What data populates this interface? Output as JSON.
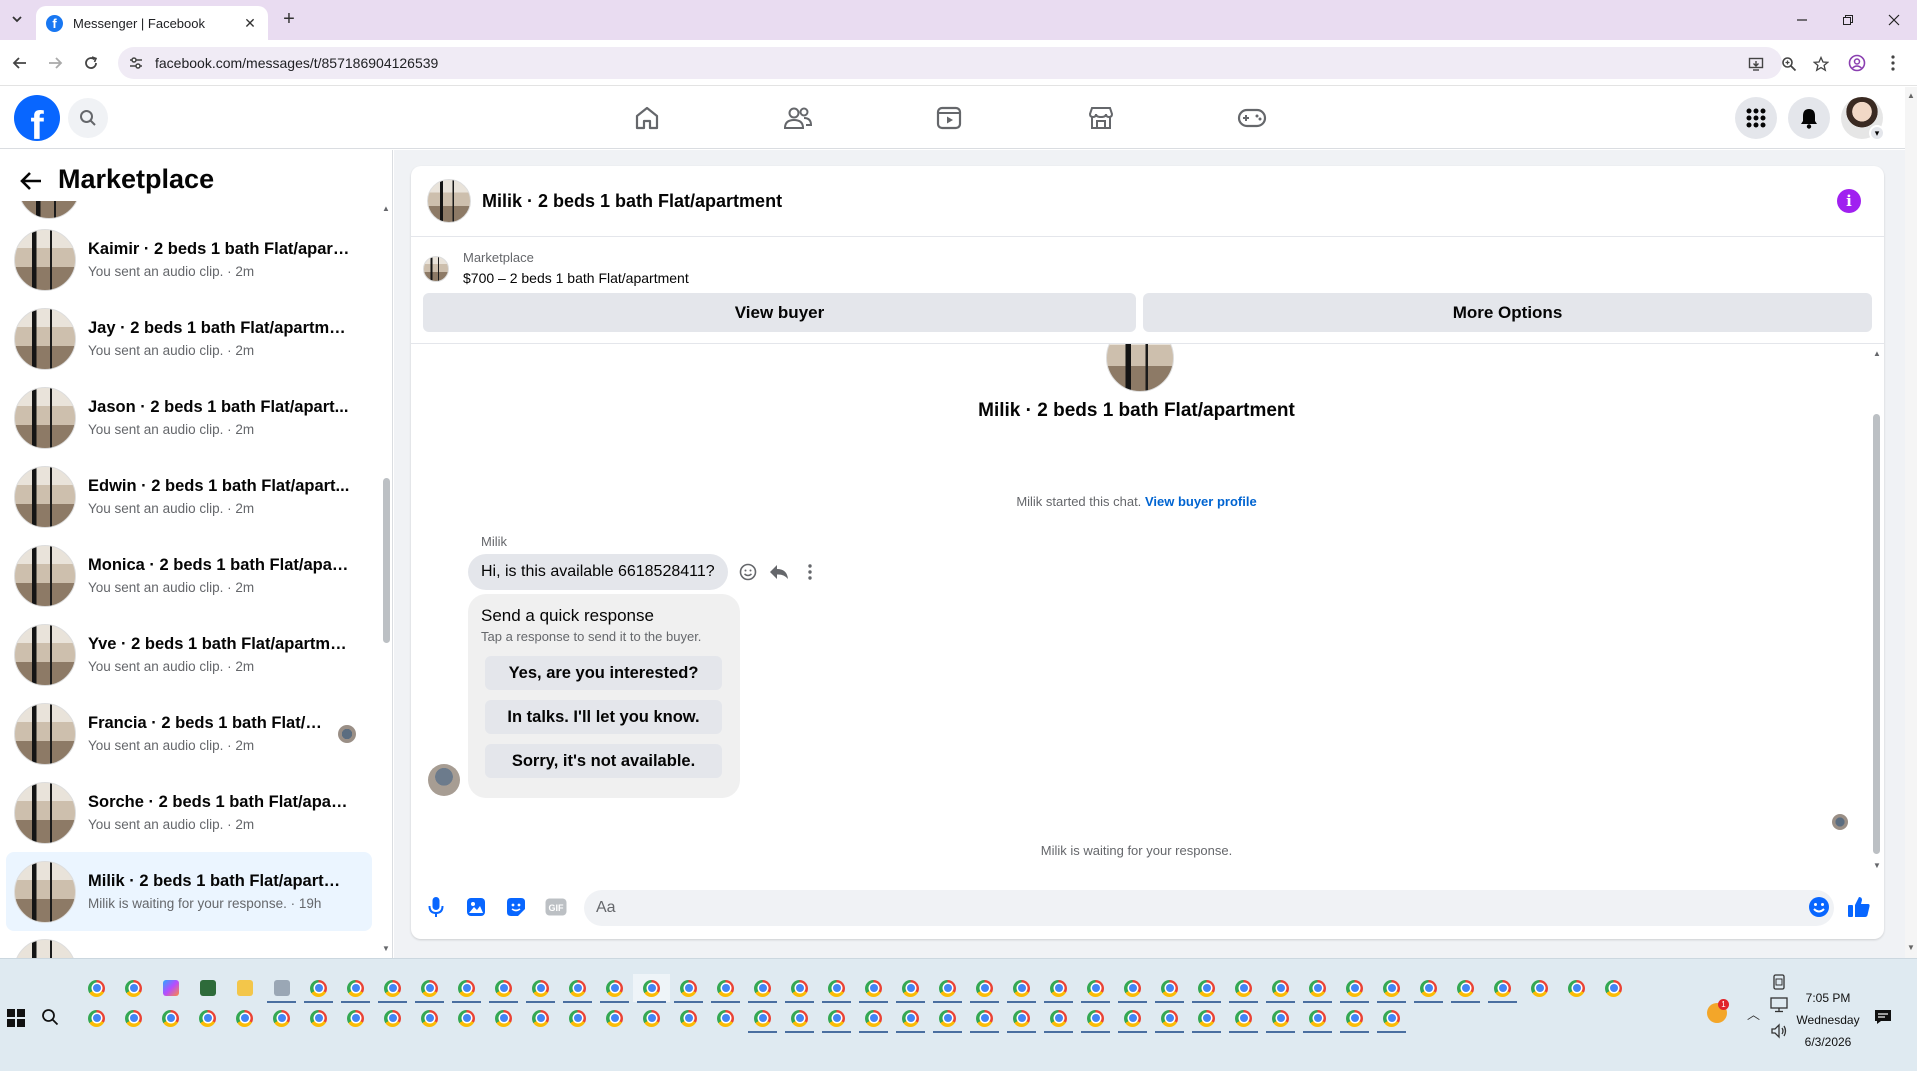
{
  "browser": {
    "tab_title": "Messenger | Facebook",
    "url": "facebook.com/messages/t/857186904126539"
  },
  "sidebar": {
    "title": "Marketplace",
    "conversations": [
      {
        "name": "Kaimir · 2 beds 1 bath Flat/apart...",
        "sub": "You sent an audio clip. · 2m"
      },
      {
        "name": "Jay · 2 beds 1 bath Flat/apartment",
        "sub": "You sent an audio clip. · 2m"
      },
      {
        "name": "Jason · 2 beds 1 bath Flat/apart...",
        "sub": "You sent an audio clip. · 2m"
      },
      {
        "name": "Edwin · 2 beds 1 bath Flat/apart...",
        "sub": "You sent an audio clip. · 2m"
      },
      {
        "name": "Monica · 2 beds 1 bath Flat/apar...",
        "sub": "You sent an audio clip. · 2m"
      },
      {
        "name": "Yve · 2 beds 1 bath Flat/apartment",
        "sub": "You sent an audio clip. · 2m"
      },
      {
        "name": "Francia · 2 beds 1 bath Flat/ap...",
        "sub": "You sent an audio clip. · 2m"
      },
      {
        "name": "Sorche · 2 beds 1 bath Flat/apart...",
        "sub": "You sent an audio clip. · 2m"
      },
      {
        "name": "Milik · 2 beds 1 bath Flat/apartm...",
        "sub": "Milik is waiting for your response. · 19h"
      }
    ]
  },
  "chat": {
    "title": "Milik · 2 beds 1 bath Flat/apartment",
    "listing_label": "Marketplace",
    "listing_price": "$700 – 2 beds 1 bath Flat/apartment",
    "view_buyer": "View buyer",
    "more_options": "More Options",
    "conversation_title": "Milik · 2 beds 1 bath Flat/apartment",
    "started_text": "Milik started this chat.",
    "view_buyer_profile": "View buyer profile",
    "sender_name": "Milik",
    "message": "Hi, is this available 6618528411?",
    "quick_title": "Send a quick response",
    "quick_sub": "Tap a response to send it to the buyer.",
    "quick_replies": [
      "Yes, are you interested?",
      "In talks. I'll let you know.",
      "Sorry, it's not available."
    ],
    "waiting_text": "Milik is waiting for your response.",
    "input_placeholder": "Aa"
  },
  "taskbar": {
    "time": "7:05 PM",
    "day": "Wednesday",
    "date": "6/3/2026",
    "notification_count": "1"
  },
  "colors": {
    "fb_blue": "#0866ff",
    "link_blue": "#0064d1",
    "info_purple": "#a020f0",
    "active_conv_bg": "#ebf5ff"
  }
}
